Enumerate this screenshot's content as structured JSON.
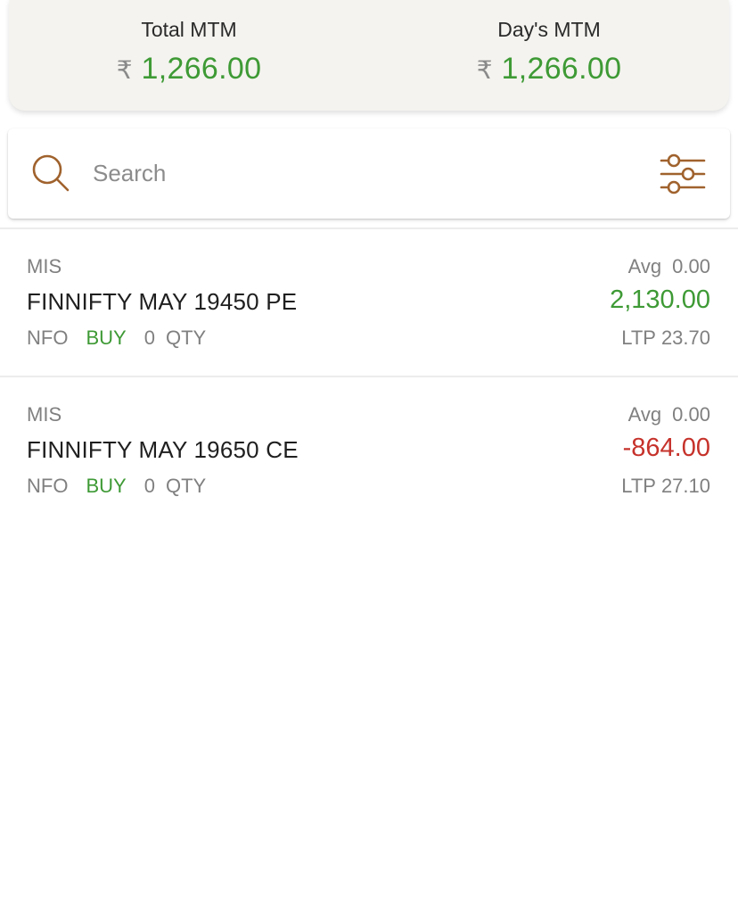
{
  "summary": {
    "total_mtm_label": "Total MTM",
    "total_mtm_currency": "₹",
    "total_mtm_value": "1,266.00",
    "days_mtm_label": "Day's MTM",
    "days_mtm_currency": "₹",
    "days_mtm_value": "1,266.00"
  },
  "search": {
    "placeholder": "Search",
    "value": "",
    "search_icon": "search-icon",
    "filter_icon": "sliders-icon"
  },
  "positions": [
    {
      "product": "MIS",
      "symbol": "FINNIFTY MAY 19450 PE",
      "exchange": "NFO",
      "side": "BUY",
      "qty": "0",
      "qty_label": "QTY",
      "avg_label": "Avg",
      "avg_value": "0.00",
      "pnl": "2,130.00",
      "ltp_label": "LTP",
      "ltp_value": "23.70"
    },
    {
      "product": "MIS",
      "symbol": "FINNIFTY MAY 19650 CE",
      "exchange": "NFO",
      "side": "BUY",
      "qty": "0",
      "qty_label": "QTY",
      "avg_label": "Avg",
      "avg_value": "0.00",
      "pnl": "-864.00",
      "ltp_label": "LTP",
      "ltp_value": "27.10"
    }
  ],
  "colors": {
    "profit": "#3e9a35",
    "loss": "#c6322b",
    "accent_icon": "#a0622d",
    "card_background": "#f4f3ef"
  }
}
